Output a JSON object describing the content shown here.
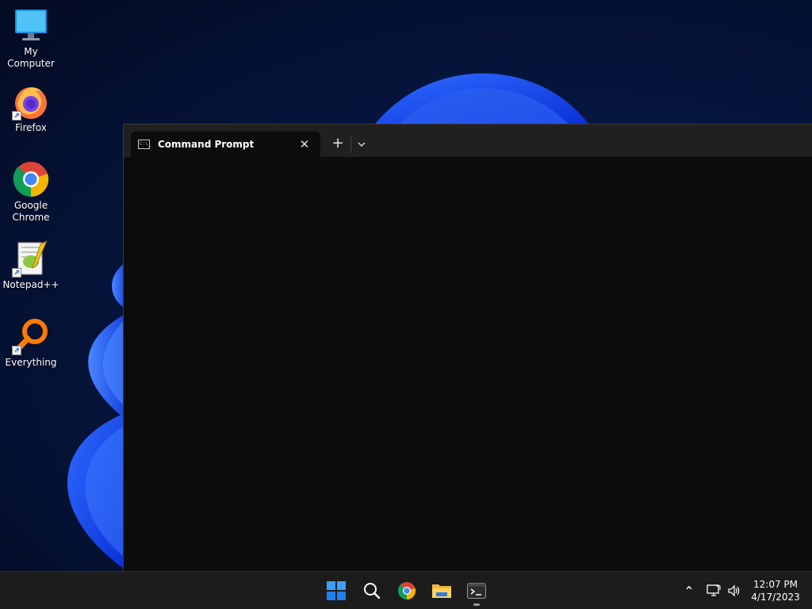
{
  "desktop": {
    "icons": [
      {
        "label": "My Computer",
        "icon": "monitor-icon"
      },
      {
        "label": "Firefox",
        "icon": "firefox-icon",
        "shortcut": true
      },
      {
        "label": "Google Chrome",
        "icon": "chrome-icon",
        "shortcut": true
      },
      {
        "label": "Notepad++",
        "icon": "notepadplusplus-icon",
        "shortcut": true
      },
      {
        "label": "Everything",
        "icon": "everything-search-icon",
        "shortcut": true
      }
    ]
  },
  "terminal": {
    "tab_title": "Command Prompt",
    "tab_icon_text": "C:\\_",
    "close_glyph": "✕",
    "new_tab_glyph": "+"
  },
  "taskbar": {
    "buttons": [
      "start-icon",
      "search-icon",
      "chrome-icon",
      "file-explorer-icon",
      "terminal-icon"
    ],
    "tray": {
      "overflow_glyph": "⌃",
      "time": "12:07 PM",
      "date": "4/17/2023"
    }
  },
  "colors": {
    "accent": "#1a5cff",
    "taskbar": "#1c1c1c",
    "terminal_bg": "#0c0c0c",
    "titlebar": "#202020"
  }
}
